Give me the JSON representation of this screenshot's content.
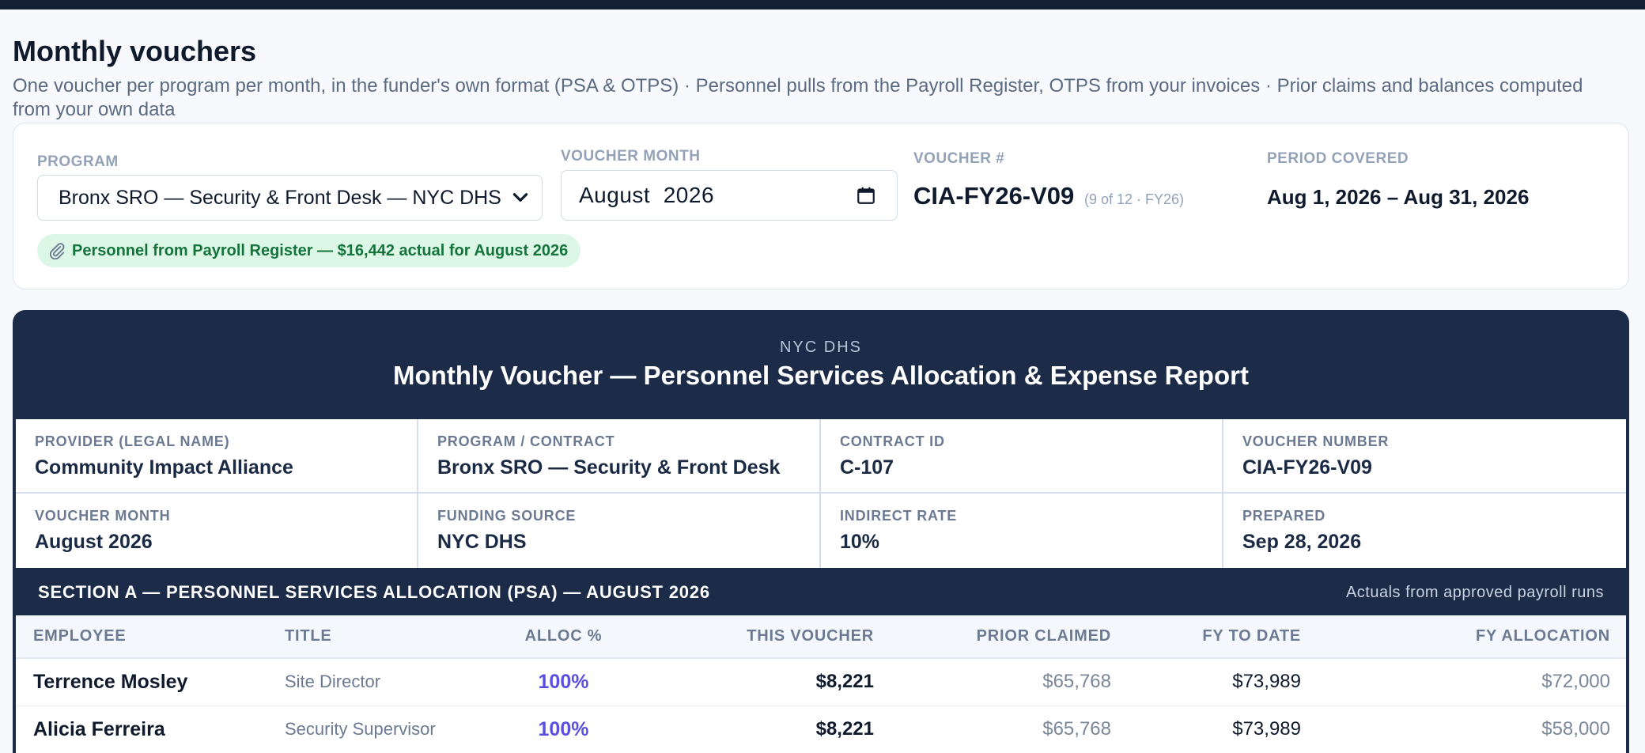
{
  "page": {
    "title": "Monthly vouchers",
    "subtitle": "One voucher per program per month, in the funder's own format (PSA & OTPS) · Personnel pulls from the Payroll Register, OTPS from your invoices · Prior claims and balances computed from your own data"
  },
  "controls": {
    "program_label": "PROGRAM",
    "program_value": "Bronx SRO — Security & Front Desk — NYC DHS",
    "month_label": "VOUCHER MONTH",
    "month_value": "August  2026",
    "voucher_label": "VOUCHER #",
    "voucher_value": "CIA-FY26-V09",
    "voucher_note": "(9 of 12 · FY26)",
    "period_label": "PERIOD COVERED",
    "period_value": "Aug 1, 2026 – Aug 31, 2026",
    "payroll_note": "Personnel from Payroll Register — $16,442 actual for August 2026"
  },
  "voucher": {
    "funder": "NYC DHS",
    "title": "Monthly Voucher — Personnel Services Allocation & Expense Report",
    "info": [
      {
        "label": "PROVIDER (LEGAL NAME)",
        "value": "Community Impact Alliance"
      },
      {
        "label": "PROGRAM / CONTRACT",
        "value": "Bronx SRO — Security & Front Desk"
      },
      {
        "label": "CONTRACT ID",
        "value": "C-107"
      },
      {
        "label": "VOUCHER NUMBER",
        "value": "CIA-FY26-V09"
      },
      {
        "label": "VOUCHER MONTH",
        "value": "August 2026"
      },
      {
        "label": "FUNDING SOURCE",
        "value": "NYC DHS"
      },
      {
        "label": "INDIRECT RATE",
        "value": "10%"
      },
      {
        "label": "PREPARED",
        "value": "Sep 28, 2026"
      }
    ],
    "section_a": {
      "title": "SECTION A — PERSONNEL SERVICES ALLOCATION (PSA) — AUGUST 2026",
      "note": "Actuals from approved payroll runs",
      "columns": [
        "EMPLOYEE",
        "TITLE",
        "ALLOC %",
        "THIS VOUCHER",
        "PRIOR CLAIMED",
        "FY TO DATE",
        "FY ALLOCATION"
      ],
      "rows": [
        {
          "employee": "Terrence Mosley",
          "title": "Site Director",
          "alloc": "100%",
          "this_voucher": "$8,221",
          "prior": "$65,768",
          "fytd": "$73,989",
          "fy_alloc": "$72,000"
        },
        {
          "employee": "Alicia Ferreira",
          "title": "Security Supervisor",
          "alloc": "100%",
          "this_voucher": "$8,221",
          "prior": "$65,768",
          "fytd": "$73,989",
          "fy_alloc": "$58,000"
        }
      ]
    }
  },
  "colors": {
    "navy": "#1c2c48",
    "accent_purple": "#5b4fe0",
    "success_bg": "#dcf7e6",
    "success_text": "#15733c"
  }
}
